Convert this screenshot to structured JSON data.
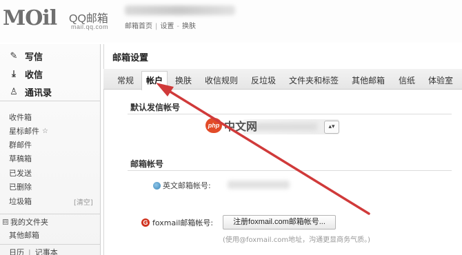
{
  "header": {
    "logo_text": "MOil",
    "logo_brand": "QQ邮箱",
    "logo_domain": "mail.qq.com",
    "links": [
      "邮箱首页",
      "设置",
      "换肤"
    ]
  },
  "sidebar": {
    "compose": "写信",
    "inbox_action": "收信",
    "contacts": "通讯录",
    "folders": [
      "收件箱",
      "星标邮件",
      "群邮件",
      "草稿箱",
      "已发送",
      "已删除",
      "垃圾箱"
    ],
    "trash_clear": "[清空]",
    "my_folders": "我的文件夹",
    "my_folders_toggle": "⊟",
    "other_mail": "其他邮箱",
    "bottom_links": [
      "日历",
      "记事本"
    ]
  },
  "main": {
    "title": "邮箱设置",
    "tabs": [
      "常规",
      "帐户",
      "换肤",
      "收信规则",
      "反垃圾",
      "文件夹和标签",
      "其他邮箱",
      "信纸",
      "体验室"
    ],
    "active_tab": "帐户",
    "default_sender_title": "默认发信帐号",
    "mail_account_title": "邮箱帐号",
    "en_account_label": "英文邮箱帐号:",
    "foxmail_label": "foxmail邮箱帐号:",
    "register_button": "注册foxmail.com邮箱帐号...",
    "foxmail_hint": "(使用@foxmail.com地址，沟通更显商务气质。)"
  },
  "watermark": {
    "logo": "php",
    "text": "中文网"
  },
  "colors": {
    "arrow": "#d03a3a",
    "accent_red": "#d0321e"
  },
  "icons": {
    "compose": "pencil-icon",
    "inbox": "download-icon",
    "contacts": "person-icon",
    "star": "star-icon",
    "select": "select-arrows-icon",
    "qq": "qq-icon",
    "foxmail": "foxmail-icon"
  }
}
